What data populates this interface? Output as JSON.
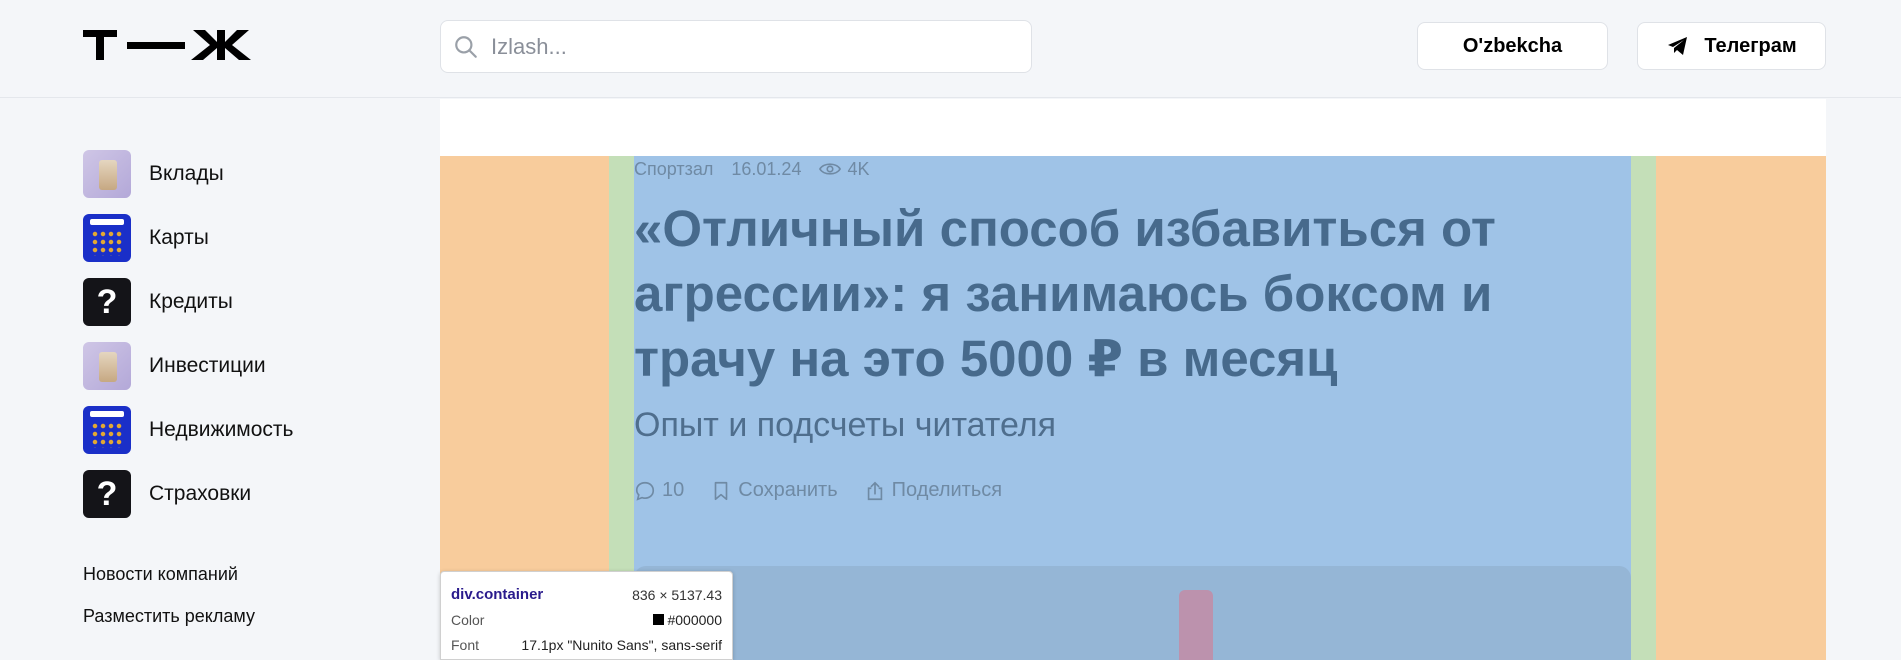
{
  "header": {
    "logo": "Т—Ж",
    "search_placeholder": "Izlash...",
    "lang_button": "O'zbekcha",
    "telegram_button": "Телеграм"
  },
  "sidebar": {
    "items": [
      {
        "label": "Вклады",
        "icon": "gift-bag-icon"
      },
      {
        "label": "Карты",
        "icon": "calculator-icon"
      },
      {
        "label": "Кредиты",
        "icon": "question-icon"
      },
      {
        "label": "Инвестиции",
        "icon": "gift-bag-icon"
      },
      {
        "label": "Недвижимость",
        "icon": "calculator-icon"
      },
      {
        "label": "Страховки",
        "icon": "question-icon"
      }
    ],
    "links": [
      "Новости компаний",
      "Разместить рекламу"
    ]
  },
  "article": {
    "category": "Спортзал",
    "date": "16.01.24",
    "views": "4K",
    "title": "«Отличный способ избавиться от агрессии»: я занимаюсь боксом и трачу на это 5000 ₽ в месяц",
    "subtitle": "Опыт и подсчеты читателя",
    "comments": "10",
    "save_label": "Сохранить",
    "share_label": "Поделиться"
  },
  "inspector": {
    "tag": "div",
    "class": ".container",
    "dimensions": "836 × 5137.43",
    "color_key": "Color",
    "color_value": "#000000",
    "font_key": "Font",
    "font_value": "17.1px \"Nunito Sans\", sans-serif"
  },
  "colors": {
    "margin_highlight": "#f8cc9c",
    "padding_highlight": "#c4dfb8",
    "content_highlight": "#9fc3e7"
  }
}
